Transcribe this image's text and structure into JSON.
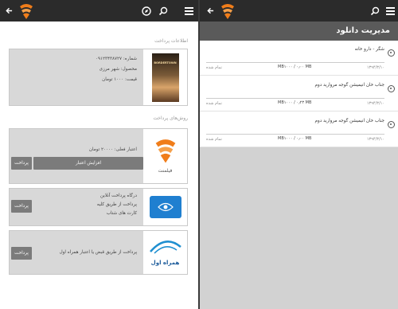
{
  "left": {
    "section_order": "اطلاعات پرداخت",
    "order": {
      "phone": "شماره: ۰۹۱۲۳۴۳۸۷۲۷",
      "product": "محصول: شهر مرزی",
      "price": "قیمت: ۱۰۰۰ تومان",
      "poster_title": "BORDERTOWN"
    },
    "section_methods": "روش‌های پرداخت",
    "methods": [
      {
        "brand": "فیلمنت",
        "lines": [
          "اعتبار فعلی: ۲۰۰۰۰ تومان"
        ],
        "secondary_button": "افزایش اعتبار",
        "pay_button": "پرداخت"
      },
      {
        "brand": "درگاه پرداخت آنلاین",
        "lines": [
          "درگاه پرداخت آنلاین",
          "پرداخت از طریق کلیه",
          "کارت های شتاب"
        ],
        "pay_button": "پرداخت"
      },
      {
        "brand": "همراه اول",
        "lines": [
          "پرداخت از طریق قبض یا اعتبار همراه اول"
        ],
        "pay_button": "پرداخت"
      }
    ]
  },
  "right": {
    "title": "مدیریت دانلود",
    "downloads": [
      {
        "name": "شگر - دارو خانه",
        "size": "MB۱۰۰۰ / ۰٫۰۰ MB",
        "date": "۱۳۹۴/۳/۱۰",
        "status": "تمام شده"
      },
      {
        "name": "جناب خان انیمیشن گوجه مروارید دوم",
        "size": "MB۱۰۰۰ / ۰٫۲۳ MB",
        "date": "۱۳۹۴/۳/۱۰",
        "status": "تمام شده"
      },
      {
        "name": "جناب خان انیمیشن گوجه مروارید دوم",
        "size": "MB۱۰۰۰ / ۰٫۰۰ MB",
        "date": "۱۳۹۴/۳/۱۰",
        "status": "تمام شده"
      }
    ]
  },
  "colors": {
    "topbar": "#2b2b2b",
    "logo_orange": "#f07d1a",
    "panel_title": "#5a5a5a",
    "button": "#7b7b7b",
    "card": "#d8d8d8"
  },
  "icons": [
    "back-arrow-icon",
    "app-logo-icon",
    "search-icon",
    "compass-icon",
    "menu-icon",
    "download-status-icon"
  ]
}
